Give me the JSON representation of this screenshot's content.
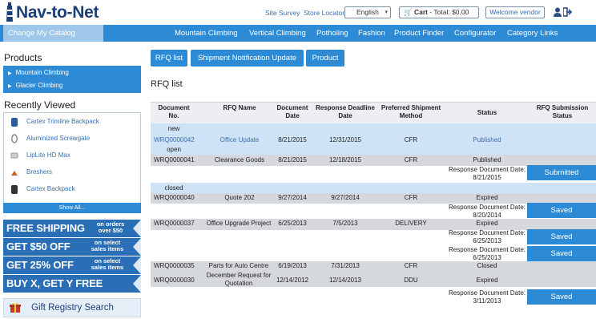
{
  "header": {
    "logo_text": "Nav-to-Net",
    "links": [
      "Site Survey",
      "Store Locator"
    ],
    "language": "English",
    "cart_label": "Cart",
    "cart_total": "- Total: $0.00",
    "welcome": "Welcome vendor",
    "icons": [
      "user-icon",
      "logout-icon"
    ]
  },
  "nav": {
    "catalog_button": "Change My Catalog",
    "items": [
      "Mountain Climbing",
      "Vertical Climbing",
      "Potholing",
      "Fashion",
      "Product Finder",
      "Configurator",
      "Category Links"
    ]
  },
  "sidebar": {
    "products_heading": "Products",
    "products": [
      "Mountain Climbing",
      "Glacier Climbing"
    ],
    "recent_heading": "Recently Viewed",
    "recent": [
      "Cartex Trimline Backpack",
      "Aluminized Screwgate",
      "LipLite HD Max",
      "Breshers",
      "Cartex Backpack"
    ],
    "show_all": "Show All...",
    "promos": [
      {
        "big": "FREE SHIPPING",
        "small": "on orders over $50"
      },
      {
        "big": "GET $50 OFF",
        "small": "on select sales items"
      },
      {
        "big": "GET 25% OFF",
        "small": "on select sales items"
      },
      {
        "big": "BUY X, GET Y FREE",
        "small": ""
      }
    ],
    "gift": "Gift Registry Search"
  },
  "tabs": [
    "RFQ list",
    "Shipment Notification Update",
    "Product"
  ],
  "page_title": "RFQ list",
  "table": {
    "headers": [
      "Document No.",
      "RFQ Name",
      "Document Date",
      "Response Deadline Date",
      "Preferred Shipment Method",
      "Status",
      "RFQ Submission Status"
    ],
    "groups": {
      "new": "new",
      "open": "open",
      "closed": "closed"
    },
    "rows": {
      "r1": {
        "doc": "WRQ0000042",
        "name": "Office Update",
        "date": "8/21/2015",
        "deadline": "12/31/2015",
        "method": "CFR",
        "status": "Published"
      },
      "r2": {
        "doc": "WRQ0000041",
        "name": "Clearance Goods",
        "date": "8/21/2015",
        "deadline": "12/18/2015",
        "method": "CFR",
        "status": "Published",
        "resp_label": "Response Document Date:",
        "resp_date": "8/21/2015",
        "button": "Submitted"
      },
      "r3": {
        "doc": "WRQ0000040",
        "name": "Quote 202",
        "date": "9/27/2014",
        "deadline": "9/27/2014",
        "method": "CFR",
        "status": "Expired",
        "resp_label": "Response Document Date:",
        "resp_date": "8/20/2014",
        "button": "Saved"
      },
      "r4": {
        "doc": "WRQ0000037",
        "name": "Office Upgrade Project",
        "date": "6/25/2013",
        "deadline": "7/5/2013",
        "method": "DELIVERY",
        "status": "Expired",
        "resp_label": "Response Document Date:",
        "resp_date": "6/25/2013",
        "button": "Saved",
        "resp2_label": "Response Document Date:",
        "resp2_date": "6/25/2013",
        "button2": "Saved"
      },
      "r5": {
        "doc": "WRQ0000035",
        "name": "Parts for Auto Centre",
        "date": "6/19/2013",
        "deadline": "7/31/2013",
        "method": "CFR",
        "status": "Closed"
      },
      "r6": {
        "doc": "WRQ0000030",
        "name": "December Request for Quotation",
        "date": "12/14/2012",
        "deadline": "12/14/2013",
        "method": "DDU",
        "status": "Expired",
        "resp_label": "Response Document Date:",
        "resp_date": "3/11/2013",
        "button": "Saved"
      }
    }
  }
}
